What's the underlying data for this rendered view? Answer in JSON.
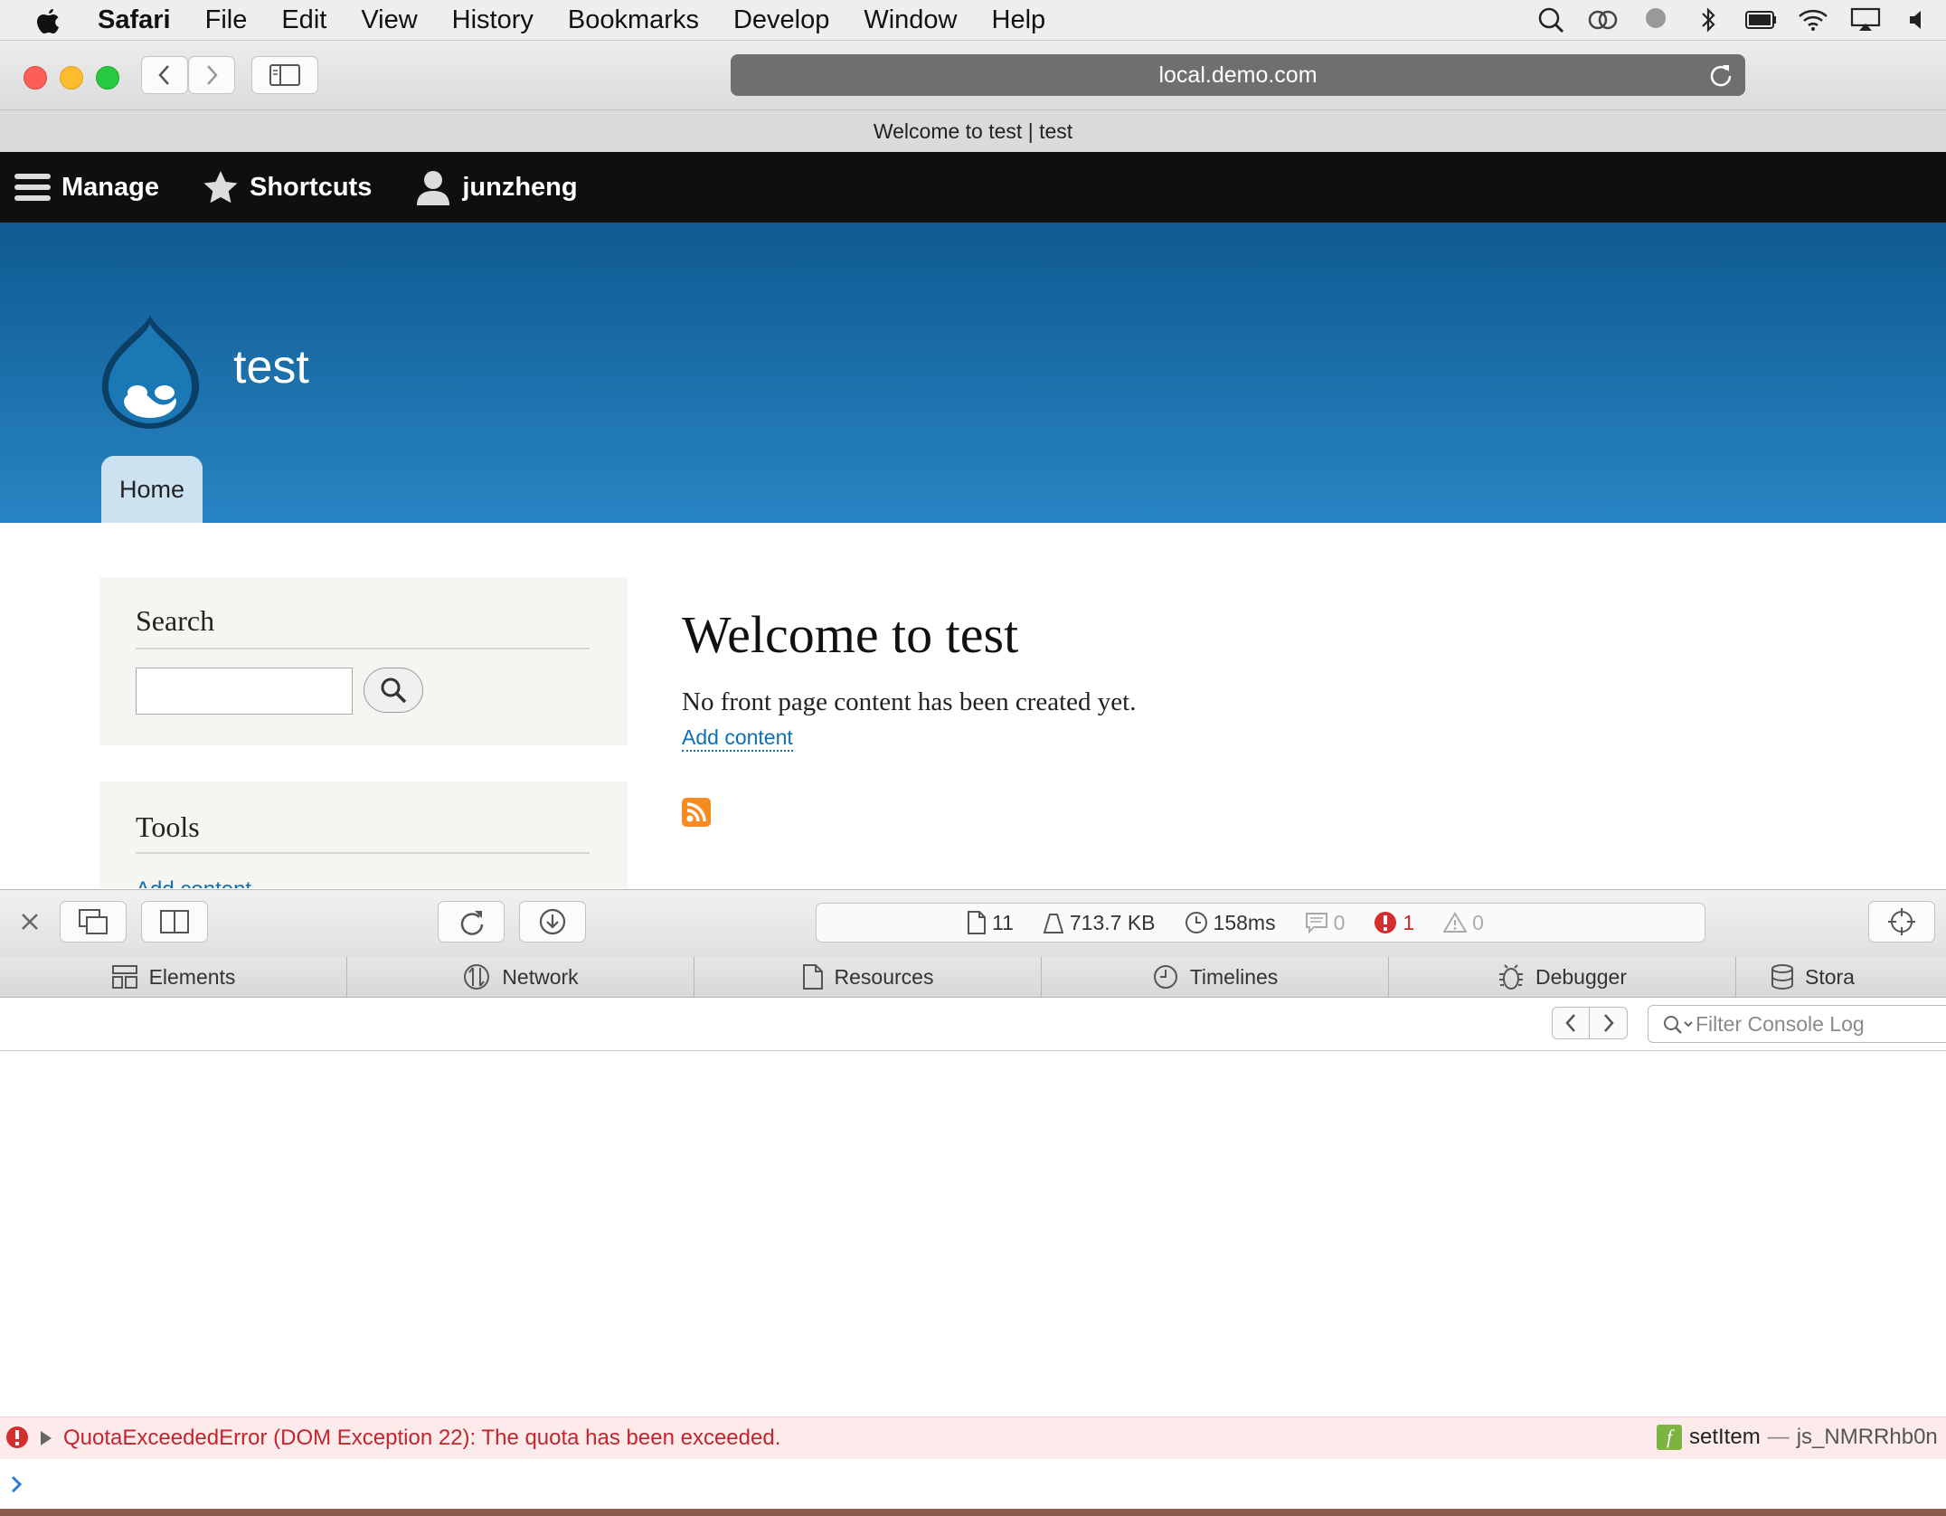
{
  "menubar": {
    "app": "Safari",
    "items": [
      "File",
      "Edit",
      "View",
      "History",
      "Bookmarks",
      "Develop",
      "Window",
      "Help"
    ]
  },
  "safari": {
    "url": "local.demo.com",
    "tab_title": "Welcome to test | test"
  },
  "admin_toolbar": {
    "manage": "Manage",
    "shortcuts": "Shortcuts",
    "user": "junzheng"
  },
  "header": {
    "site_name": "test",
    "nav_home": "Home",
    "colors": {
      "top": "#0f5a91",
      "bottom": "#2885c3"
    }
  },
  "sidebar": {
    "search_title": "Search",
    "tools_title": "Tools",
    "tools_partial_link": "Add content"
  },
  "main": {
    "title": "Welcome to test",
    "message": "No front page content has been created yet.",
    "link": "Add content"
  },
  "inspector": {
    "activity": {
      "resources": "11",
      "size": "713.7 KB",
      "time": "158ms",
      "logs": "0",
      "errors": "1",
      "warnings": "0"
    },
    "tabs": [
      "Elements",
      "Network",
      "Resources",
      "Timelines",
      "Debugger",
      "Stora"
    ],
    "filter_placeholder": "Filter Console Log",
    "error_message": "QuotaExceededError (DOM Exception 22): The quota has been exceeded.",
    "error_source_fn": "setItem",
    "error_source_sep": "—",
    "error_source_file": "js_NMRRhb0n"
  }
}
